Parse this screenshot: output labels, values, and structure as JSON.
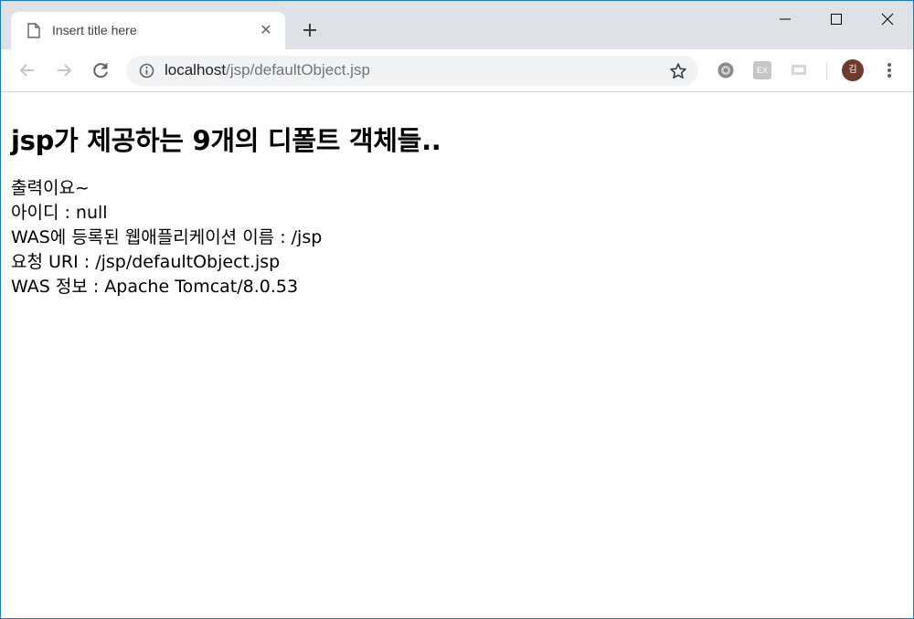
{
  "tab": {
    "title": "Insert title here",
    "close_glyph": "✕"
  },
  "newtab": {
    "glyph": "+"
  },
  "omnibox": {
    "host": "localhost",
    "path": "/jsp/defaultObject.jsp"
  },
  "extensions": [
    {
      "icon": "gear-extension-icon"
    },
    {
      "icon": "ex-extension-icon",
      "label": "EX"
    },
    {
      "icon": "screen-extension-icon"
    }
  ],
  "profile": {
    "initial": "김"
  },
  "page": {
    "heading": "jsp가 제공하는 9개의 디폴트 객체들..",
    "lines": [
      "출력이요~",
      "아이디 : null",
      "WAS에 등록된 웹애플리케이션 이름 : /jsp",
      "요청 URI : /jsp/defaultObject.jsp",
      "WAS 정보 : Apache Tomcat/8.0.53"
    ]
  },
  "colors": {
    "frame": "#1979ca",
    "tabstrip": "#dee1e6",
    "omnibox": "#f1f3f4",
    "avatar": "#6d3b2e"
  }
}
